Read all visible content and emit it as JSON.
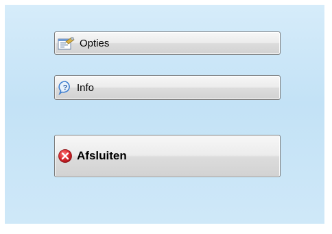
{
  "menu": {
    "buttons": [
      {
        "label": "Opties",
        "icon": "settings-form-icon"
      },
      {
        "label": "Info",
        "icon": "help-icon"
      },
      {
        "label": "Afsluiten",
        "icon": "close-icon"
      }
    ]
  },
  "colors": {
    "background": "#c9e5f7",
    "button_border": "#7a7a7a",
    "exit_icon": "#d8262c",
    "help_icon": "#3f7fd0"
  }
}
